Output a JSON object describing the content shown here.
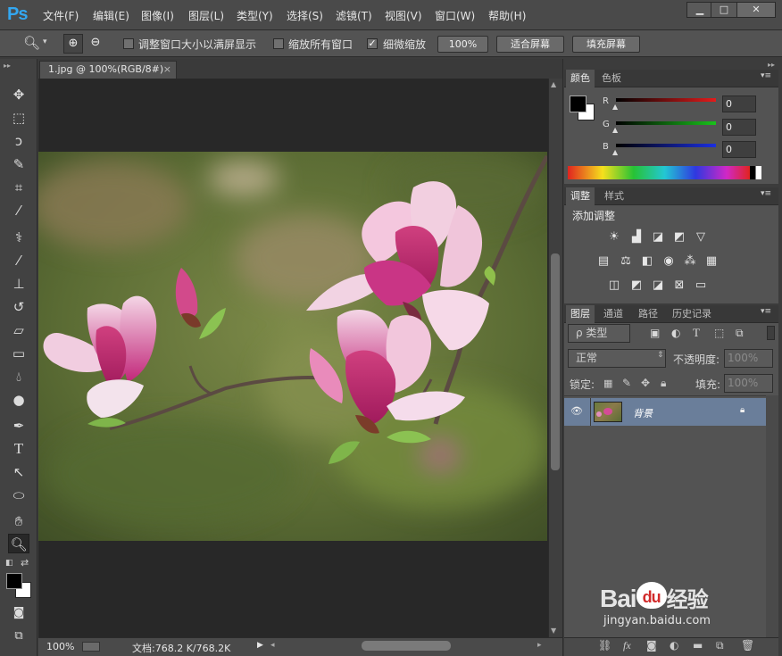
{
  "app": {
    "logo": "Ps"
  },
  "menu": [
    "文件(F)",
    "编辑(E)",
    "图像(I)",
    "图层(L)",
    "类型(Y)",
    "选择(S)",
    "滤镜(T)",
    "视图(V)",
    "窗口(W)",
    "帮助(H)"
  ],
  "window_controls": {
    "minimize": "▁",
    "maximize": "□",
    "close": "✕"
  },
  "options": {
    "resize_windows": "调整窗口大小以满屏显示",
    "zoom_all": "缩放所有窗口",
    "scrubby_zoom": "细微缩放",
    "scrubby_checked": true,
    "btn_100": "100%",
    "btn_fit": "适合屏幕",
    "btn_fill": "填充屏幕"
  },
  "document": {
    "tab_title": "1.jpg @ 100%(RGB/8#)",
    "close": "×"
  },
  "status": {
    "zoom": "100%",
    "docinfo": "文档:768.2 K/768.2K"
  },
  "color_panel": {
    "tabs": [
      "颜色",
      "色板"
    ],
    "channels": [
      {
        "label": "R",
        "value": "0",
        "color": "#e31b1b"
      },
      {
        "label": "G",
        "value": "0",
        "color": "#19c21b"
      },
      {
        "label": "B",
        "value": "0",
        "color": "#1b2fe0"
      }
    ]
  },
  "adjust_panel": {
    "tabs": [
      "调整",
      "样式"
    ],
    "title": "添加调整"
  },
  "layers_panel": {
    "tabs": [
      "图层",
      "通道",
      "路径",
      "历史记录"
    ],
    "filter": "ρ 类型",
    "blend_mode": "正常",
    "opacity_label": "不透明度:",
    "opacity_value": "100%",
    "lock_label": "锁定:",
    "fill_label": "填充:",
    "fill_value": "100%",
    "layers": [
      {
        "name": "背景",
        "visible": true,
        "locked": true
      }
    ]
  },
  "watermark": {
    "brand": "Bai",
    "paw": "du",
    "suffix": "经验",
    "url": "jingyan.baidu.com"
  }
}
